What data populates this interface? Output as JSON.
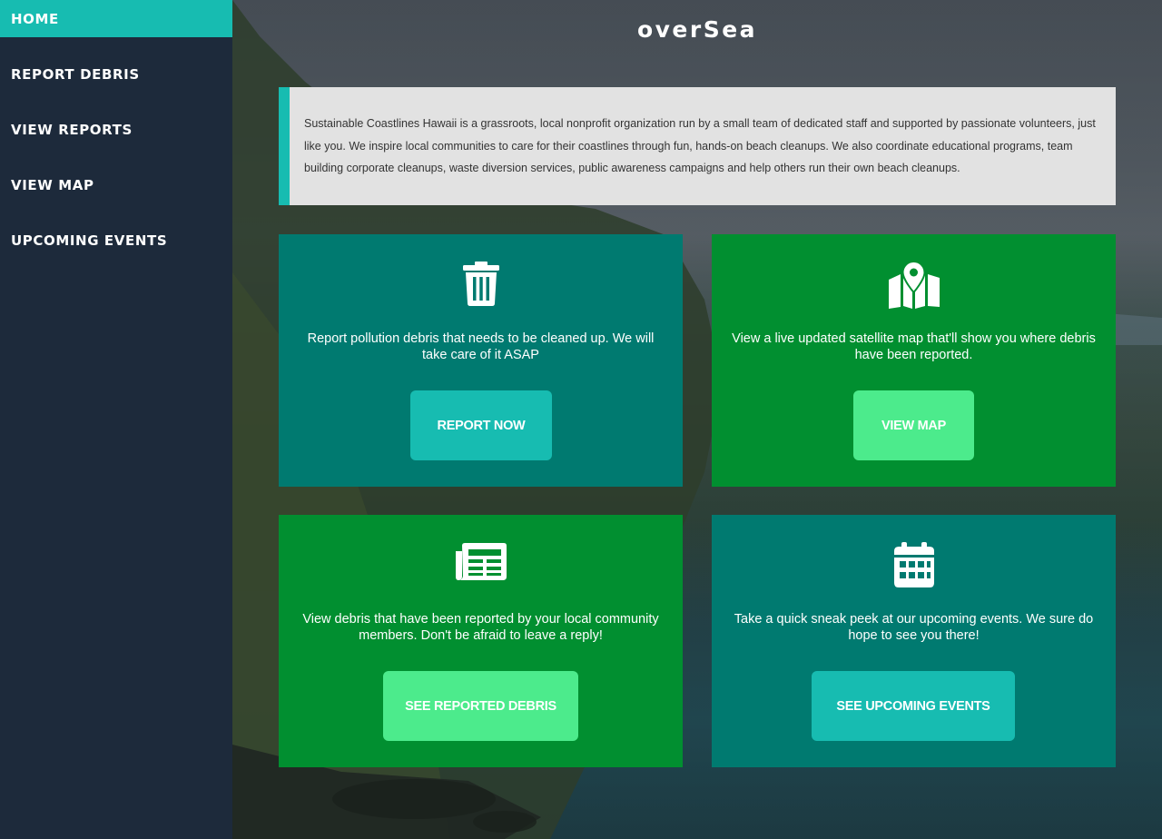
{
  "sidebar": {
    "items": [
      {
        "label": "HOME",
        "active": true
      },
      {
        "label": "REPORT DEBRIS",
        "active": false
      },
      {
        "label": "VIEW REPORTS",
        "active": false
      },
      {
        "label": "VIEW MAP",
        "active": false
      },
      {
        "label": "UPCOMING EVENTS",
        "active": false
      }
    ]
  },
  "header": {
    "brand": "overSea"
  },
  "about": {
    "text": "Sustainable Coastlines Hawaii is a grassroots, local nonprofit organization run by a small team of dedicated staff and supported by passionate volunteers, just like you. We inspire local communities to care for their coastlines through fun, hands-on beach cleanups. We also coordinate educational programs, team building corporate cleanups, waste diversion services, public awareness campaigns and help others run their own beach cleanups."
  },
  "cards": [
    {
      "icon": "trash-icon",
      "text": "Report pollution debris that needs to be cleaned up. We will take care of it ASAP",
      "button": "REPORT NOW"
    },
    {
      "icon": "map-icon",
      "text": "View a live updated satellite map that'll show you where debris have been reported.",
      "button": "VIEW MAP"
    },
    {
      "icon": "newspaper-icon",
      "text": "View debris that have been reported by your local community members. Don't be afraid to leave a reply!",
      "button": "SEE REPORTED DEBRIS"
    },
    {
      "icon": "calendar-icon",
      "text": "Take a quick sneak peek at our upcoming events. We sure do hope to see you there!",
      "button": "SEE UPCOMING EVENTS"
    }
  ],
  "colors": {
    "sidebar": "#1d2a3b",
    "accent": "#17bcb1",
    "card_teal": "#007a70",
    "card_green": "#018f30",
    "button_green": "#4ceb8c"
  }
}
